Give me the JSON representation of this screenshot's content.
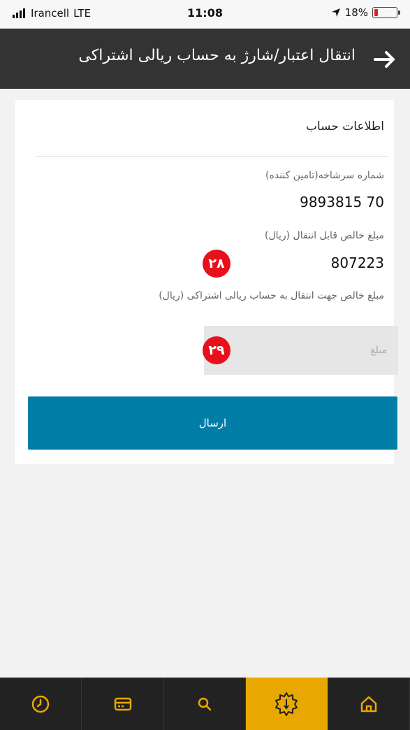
{
  "status_bar": {
    "carrier": "Irancell",
    "network": "LTE",
    "time": "11:08",
    "battery": "18%",
    "battery_level": 0.18
  },
  "header": {
    "title": "انتقال اعتبار/شارژ به حساب ریالی اشتراکی",
    "back_icon": "arrow-right-icon"
  },
  "card": {
    "section_title": "اطلاعات حساب",
    "subscriber_label": "شماره سرشاخه(تامین کننده)",
    "subscriber_value": "9893815   70",
    "transferable_label": "مبلغ خالص قابل انتقال (ریال)",
    "transferable_value": "807223",
    "transfer_label": "مبلغ خالص جهت انتقال به حساب ریالی اشتراکی (ریال)",
    "amount_placeholder": "مبلغ",
    "submit_label": "ارسال"
  },
  "annotations": {
    "badge_28": "۲۸",
    "badge_29": "۲۹"
  },
  "tabs": [
    {
      "icon": "clock-icon"
    },
    {
      "icon": "card-icon"
    },
    {
      "icon": "search-icon"
    },
    {
      "icon": "gear-icon",
      "active": true
    },
    {
      "icon": "home-icon"
    }
  ],
  "colors": {
    "header_bg": "#333333",
    "button_bg": "#007ea7",
    "active_tab": "#e9a800",
    "badge": "#e8101b",
    "tabbar_bg": "#222222"
  }
}
